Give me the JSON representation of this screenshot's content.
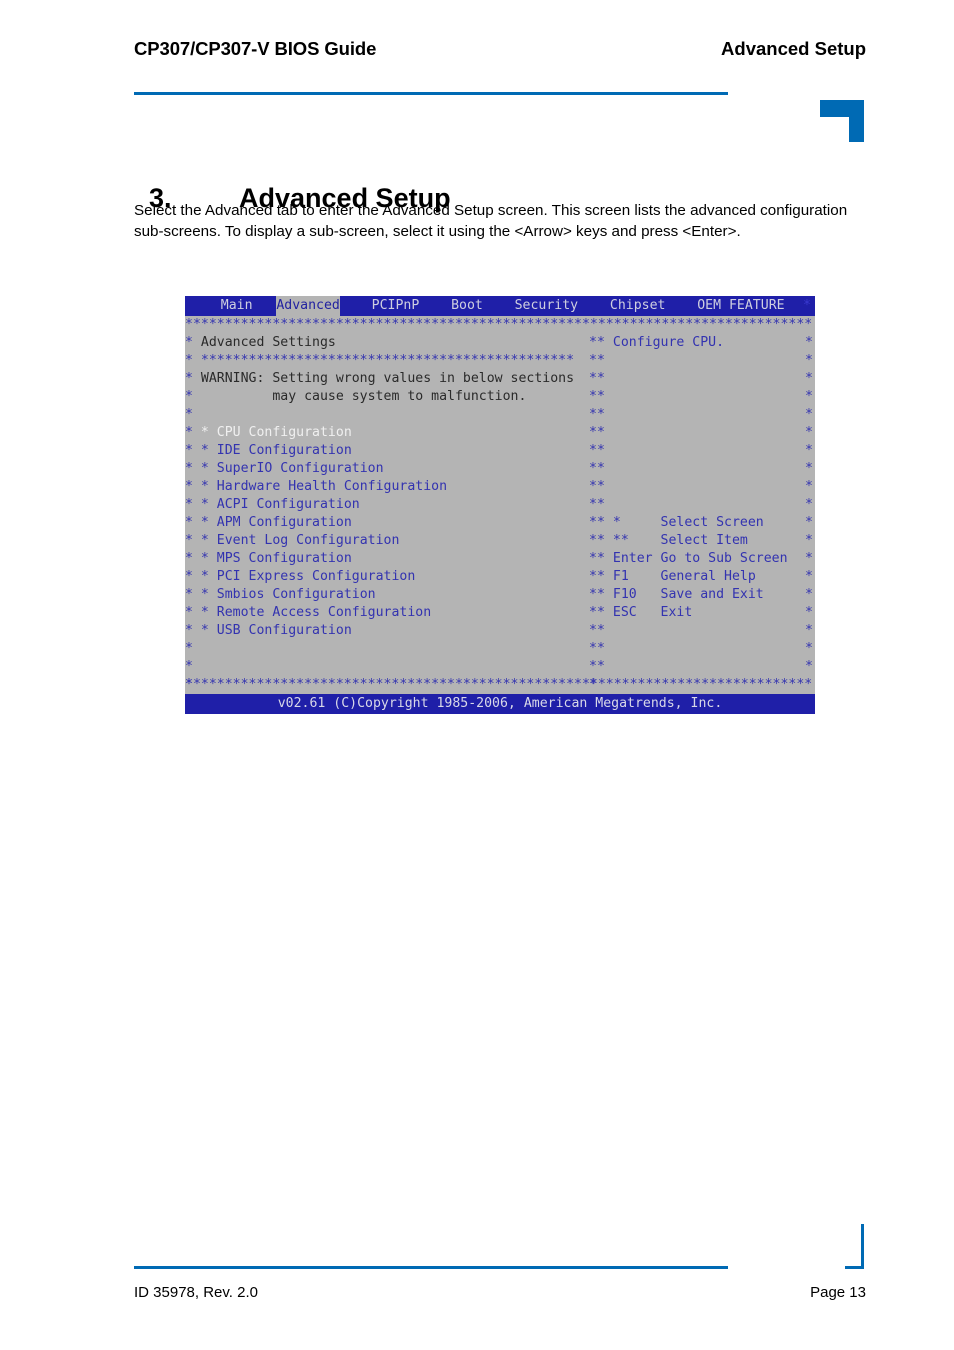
{
  "header": {
    "left_title": "CP307/CP307-V BIOS Guide",
    "right_title": "Advanced Setup"
  },
  "section": {
    "number": "3.",
    "title": "Advanced Setup",
    "paragraph": "Select the Advanced tab to enter the Advanced Setup screen. This screen lists the advanced configuration sub-screens. To display a sub-screen, select it using the <Arrow> keys and press <Enter>."
  },
  "bios": {
    "menu": [
      {
        "label": "Main",
        "active": false
      },
      {
        "label": "Advanced",
        "active": true
      },
      {
        "label": "PCIPnP",
        "active": false
      },
      {
        "label": "Boot",
        "active": false
      },
      {
        "label": "Security",
        "active": false
      },
      {
        "label": "Chipset",
        "active": false
      },
      {
        "label": "OEM FEATURE",
        "active": false
      }
    ],
    "menu_edge_star": "*",
    "separator": "**************************************************************************",
    "separator_left": "*******************************************",
    "panel_title": "Advanced Settings",
    "warning_line1": "WARNING: Setting wrong values in below sections",
    "warning_line2": "may cause system to malfunction.",
    "items": [
      {
        "label": "CPU Configuration",
        "selected": true
      },
      {
        "label": "IDE Configuration",
        "selected": false
      },
      {
        "label": "SuperIO Configuration",
        "selected": false
      },
      {
        "label": "Hardware Health Configuration",
        "selected": false
      },
      {
        "label": "ACPI Configuration",
        "selected": false
      },
      {
        "label": "APM Configuration",
        "selected": false
      },
      {
        "label": "Event Log Configuration",
        "selected": false
      },
      {
        "label": "MPS Configuration",
        "selected": false
      },
      {
        "label": "PCI Express Configuration",
        "selected": false
      },
      {
        "label": "Smbios Configuration",
        "selected": false
      },
      {
        "label": "Remote Access Configuration",
        "selected": false
      },
      {
        "label": "USB Configuration",
        "selected": false
      }
    ],
    "help_text": "Configure CPU.",
    "keys": [
      {
        "key": "*",
        "action": "Select Screen"
      },
      {
        "key": "**",
        "action": "Select Item"
      },
      {
        "key": "Enter",
        "action": "Go to Sub Screen"
      },
      {
        "key": "F1",
        "action": "General Help"
      },
      {
        "key": "F10",
        "action": "Save and Exit"
      },
      {
        "key": "ESC",
        "action": "Exit"
      }
    ],
    "copyright": "v02.61 (C)Copyright 1985-2006, American Megatrends, Inc."
  },
  "footer": {
    "left": "ID 35978, Rev. 2.0",
    "right": "Page 13"
  },
  "colors": {
    "accent": "#006ab4",
    "bios_blue": "#1f1fa8",
    "bios_gray": "#b4b4b4",
    "bios_text_blue": "#3333b0"
  }
}
